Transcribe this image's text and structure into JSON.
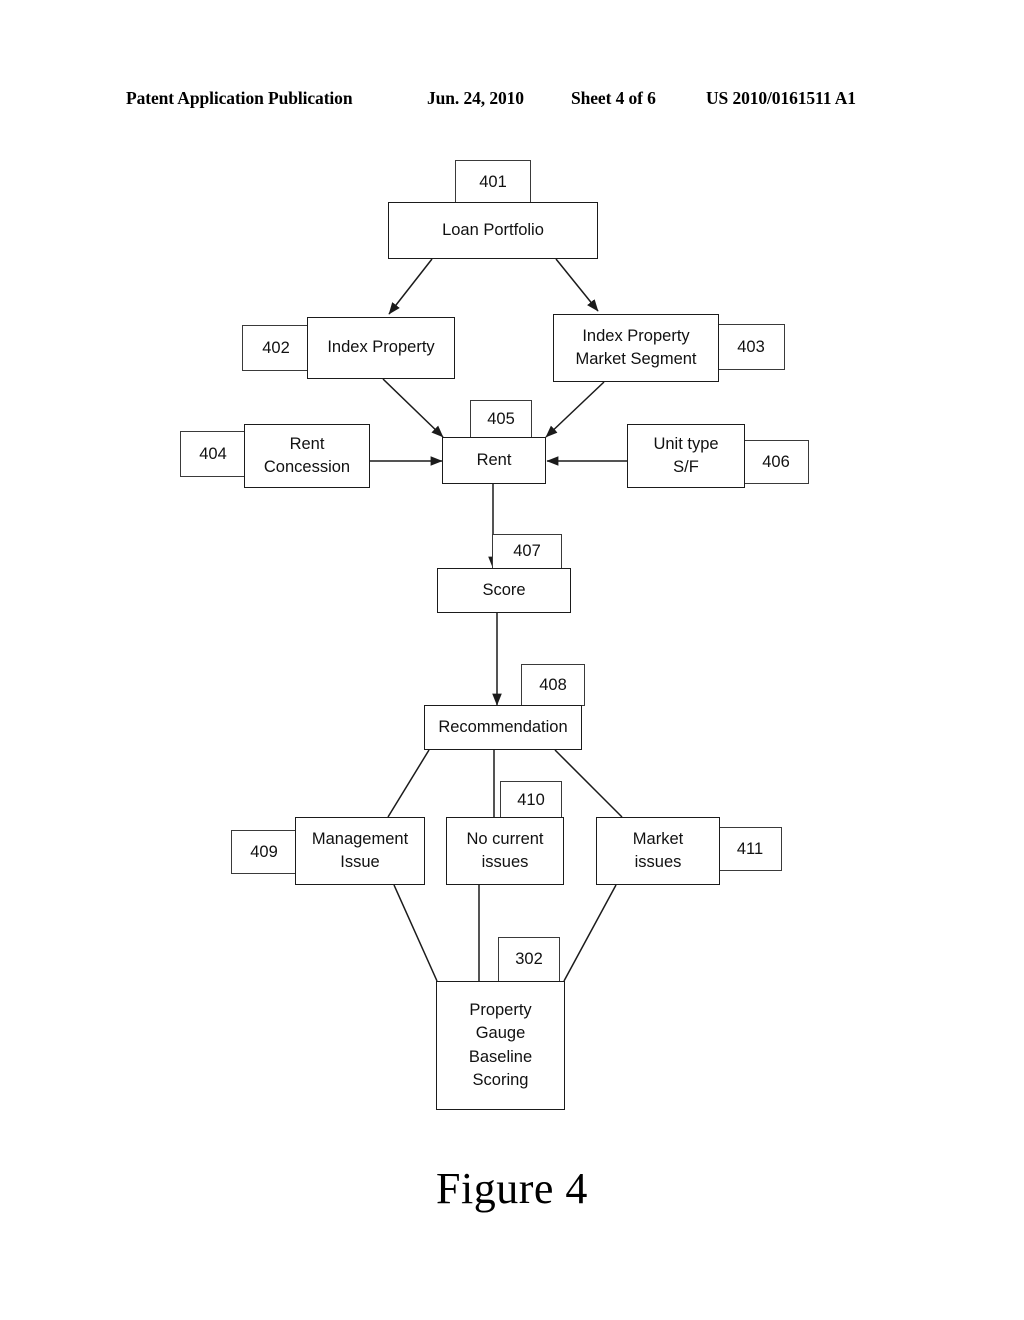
{
  "header": {
    "publication": "Patent Application Publication",
    "date": "Jun. 24, 2010",
    "sheet": "Sheet 4 of 6",
    "number": "US 2010/0161511 A1"
  },
  "figure": {
    "caption": "Figure 4"
  },
  "diagram": {
    "nodes": [
      {
        "ref": "401",
        "label": "Loan Portfolio",
        "lines": [
          "Loan Portfolio"
        ]
      },
      {
        "ref": "402",
        "label": "Index Property",
        "lines": [
          "Index Property"
        ]
      },
      {
        "ref": "403",
        "label": "Index Property Market Segment",
        "lines": [
          "Index Property",
          "Market Segment"
        ]
      },
      {
        "ref": "404",
        "label": "Rent Concession",
        "lines": [
          "Rent",
          "Concession"
        ]
      },
      {
        "ref": "405",
        "label": "Rent",
        "lines": [
          "Rent"
        ]
      },
      {
        "ref": "406",
        "label": "Unit type S/F",
        "lines": [
          "Unit type",
          "S/F"
        ]
      },
      {
        "ref": "407",
        "label": "Score",
        "lines": [
          "Score"
        ]
      },
      {
        "ref": "408",
        "label": "Recommendation",
        "lines": [
          "Recommendation"
        ]
      },
      {
        "ref": "409",
        "label": "Management Issue",
        "lines": [
          "Management",
          "Issue"
        ]
      },
      {
        "ref": "410",
        "label": "No current issues",
        "lines": [
          "No current",
          "issues"
        ]
      },
      {
        "ref": "411",
        "label": "Market issues",
        "lines": [
          "Market",
          "issues"
        ]
      },
      {
        "ref": "302",
        "label": "Property Gauge Baseline Scoring",
        "lines": [
          "Property",
          "Gauge",
          "Baseline",
          "Scoring"
        ]
      }
    ],
    "edges": [
      {
        "from": "401",
        "to": "402",
        "arrow": true
      },
      {
        "from": "401",
        "to": "403",
        "arrow": true
      },
      {
        "from": "402",
        "to": "405",
        "arrow": true
      },
      {
        "from": "403",
        "to": "405",
        "arrow": true
      },
      {
        "from": "404",
        "to": "405",
        "arrow": true
      },
      {
        "from": "406",
        "to": "405",
        "arrow": true
      },
      {
        "from": "405",
        "to": "407",
        "arrow": true
      },
      {
        "from": "407",
        "to": "408",
        "arrow": true
      },
      {
        "from": "408",
        "to": "409",
        "arrow": false
      },
      {
        "from": "408",
        "to": "410",
        "arrow": false
      },
      {
        "from": "408",
        "to": "411",
        "arrow": false
      },
      {
        "from": "409",
        "to": "302",
        "arrow": false
      },
      {
        "from": "410",
        "to": "302",
        "arrow": false
      },
      {
        "from": "411",
        "to": "302",
        "arrow": false
      }
    ],
    "colors": {
      "stroke": "#1b1b1b",
      "background": "#ffffff",
      "text": "#111111"
    }
  }
}
